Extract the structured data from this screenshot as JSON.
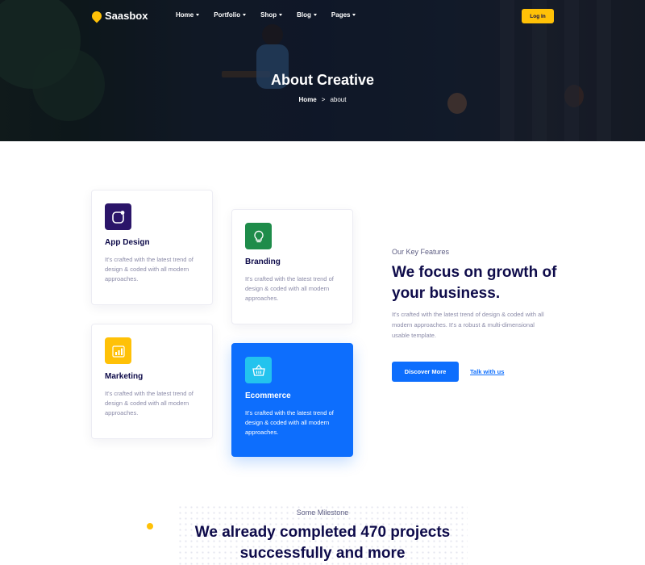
{
  "brand": {
    "name": "Saasbox",
    "logo_color": "#ffc107"
  },
  "nav": {
    "items": [
      {
        "label": "Home"
      },
      {
        "label": "Portfolio"
      },
      {
        "label": "Shop"
      },
      {
        "label": "Blog"
      },
      {
        "label": "Pages"
      }
    ],
    "login_label": "Log In"
  },
  "hero": {
    "title": "About Creative",
    "breadcrumb": {
      "home": "Home",
      "separator": ">",
      "current": "about"
    }
  },
  "features": [
    {
      "title": "App Design",
      "text": "It's crafted with the latest trend of design & coded with all modern approaches.",
      "icon": "app-icon",
      "icon_bg": "#2b1569"
    },
    {
      "title": "Branding",
      "text": "It's crafted with the latest trend of design & coded with all modern approaches.",
      "icon": "lightbulb-icon",
      "icon_bg": "#1e8c4a"
    },
    {
      "title": "Marketing",
      "text": "It's crafted with the latest trend of design & coded with all modern approaches.",
      "icon": "bar-chart-icon",
      "icon_bg": "#ffc107"
    },
    {
      "title": "Ecommerce",
      "text": "It's crafted with the latest trend of design & coded with all modern approaches.",
      "icon": "basket-icon",
      "icon_bg": "#23c3ee",
      "active": true
    }
  ],
  "key_features": {
    "subtitle": "Our Key Features",
    "title": "We focus on growth of your business.",
    "text": "It's crafted with the latest trend of design & coded with all modern approaches. It's a robust & multi-dimensional usable template.",
    "primary_button": "Discover More",
    "link": "Talk with us"
  },
  "milestone": {
    "subtitle": "Some Milestone",
    "title": "We already completed 470 projects successfully and more"
  },
  "colors": {
    "primary": "#0d6efd",
    "accent": "#ffc107",
    "heading": "#0e0b4a",
    "muted": "#8b8ba8"
  }
}
